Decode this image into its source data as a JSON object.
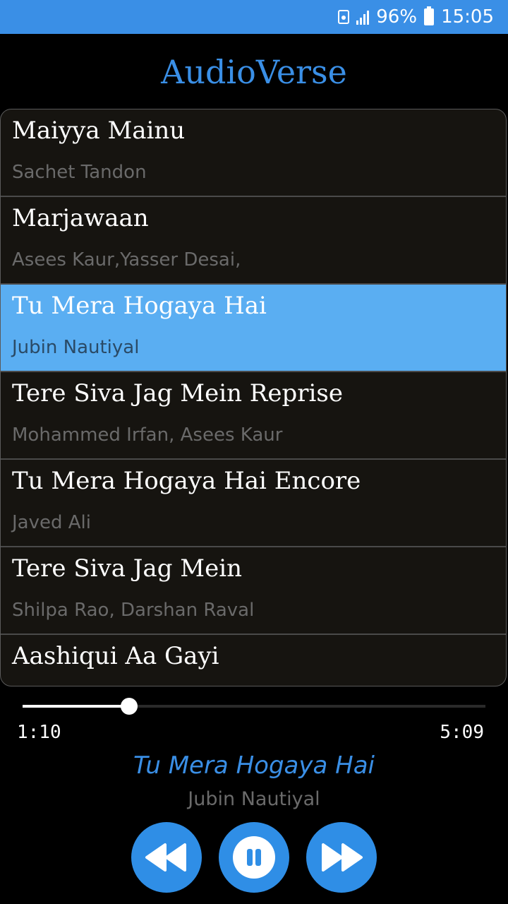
{
  "status_bar": {
    "battery": "96%",
    "time": "15:05"
  },
  "app": {
    "title": "AudioVerse"
  },
  "songs": [
    {
      "title": "Maiyya Mainu",
      "artist": "Sachet Tandon"
    },
    {
      "title": "Marjawaan",
      "artist": "Asees Kaur,Yasser Desai,"
    },
    {
      "title": "Tu Mera Hogaya Hai",
      "artist": "Jubin Nautiyal",
      "selected": true
    },
    {
      "title": "Tere Siva Jag Mein Reprise",
      "artist": "Mohammed Irfan, Asees Kaur"
    },
    {
      "title": "Tu Mera Hogaya Hai Encore",
      "artist": "Javed Ali"
    },
    {
      "title": "Tere Siva Jag Mein",
      "artist": "Shilpa Rao, Darshan Raval"
    },
    {
      "title": "Aashiqui Aa Gayi",
      "artist": ""
    }
  ],
  "player": {
    "elapsed": "1:10",
    "total": "5:09",
    "progress_fraction": 0.23,
    "now_playing_title": "Tu Mera Hogaya Hai",
    "now_playing_artist": "Jubin Nautiyal",
    "controls": [
      "rewind-icon",
      "pause-icon",
      "fast-forward-icon"
    ]
  },
  "colors": {
    "accent": "#3a8fe6",
    "selected_row": "#5aaef2",
    "button": "#2f8ee6"
  }
}
